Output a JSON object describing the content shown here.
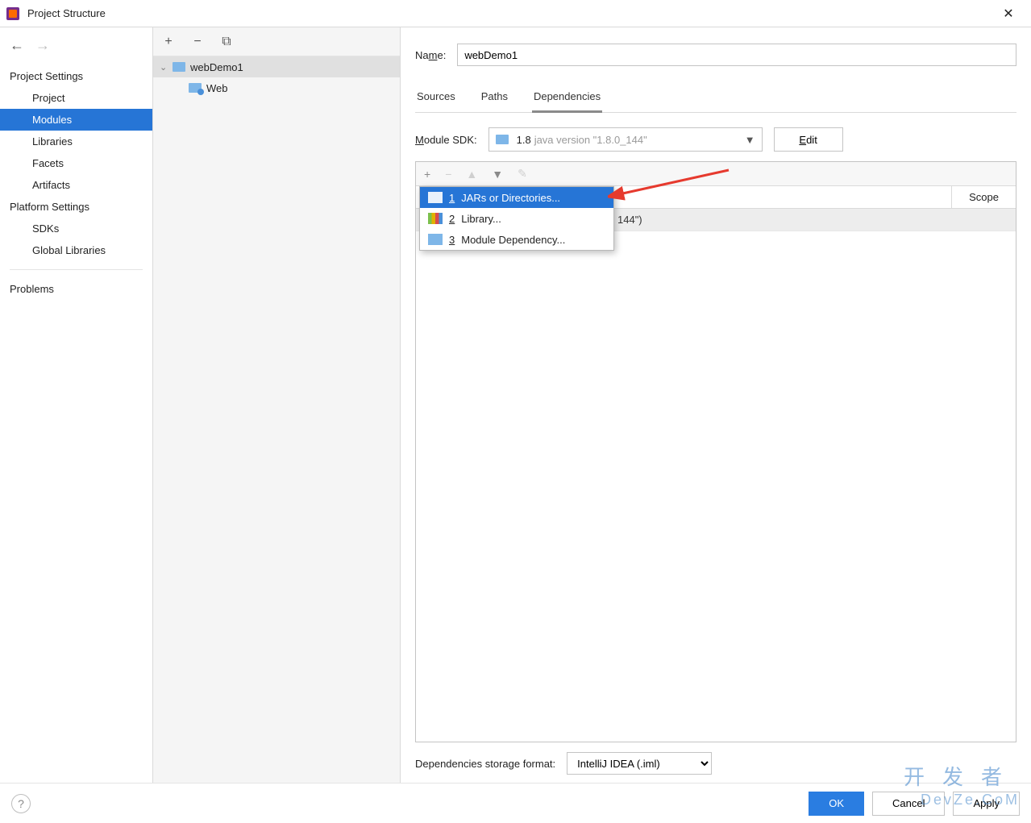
{
  "window": {
    "title": "Project Structure",
    "close_glyph": "✕"
  },
  "sidebar_nav": {
    "back_enabled": true,
    "forward_enabled": false,
    "groups": [
      {
        "heading": "Project Settings",
        "items": [
          {
            "label": "Project",
            "id": "project",
            "selected": false
          },
          {
            "label": "Modules",
            "id": "modules",
            "selected": true
          },
          {
            "label": "Libraries",
            "id": "libraries",
            "selected": false
          },
          {
            "label": "Facets",
            "id": "facets",
            "selected": false
          },
          {
            "label": "Artifacts",
            "id": "artifacts",
            "selected": false
          }
        ]
      },
      {
        "heading": "Platform Settings",
        "items": [
          {
            "label": "SDKs",
            "id": "sdks",
            "selected": false
          },
          {
            "label": "Global Libraries",
            "id": "globlib",
            "selected": false
          }
        ]
      },
      {
        "heading": null,
        "divider": true,
        "items": [
          {
            "label": "Problems",
            "id": "problems",
            "selected": false
          }
        ]
      }
    ]
  },
  "tree": {
    "toolbar": {
      "add": "+",
      "remove": "−",
      "copy": "⧉"
    },
    "root": {
      "label": "webDemo1",
      "expanded": true,
      "selected": true
    },
    "children": [
      {
        "label": "Web",
        "icon": "web"
      }
    ]
  },
  "details": {
    "name_label_prefix": "Na",
    "name_label_ul": "m",
    "name_label_suffix": "e:",
    "name_value": "webDemo1",
    "tabs": [
      {
        "label": "Sources",
        "active": false
      },
      {
        "label": "Paths",
        "active": false
      },
      {
        "label": "Dependencies",
        "active": true
      }
    ],
    "module_sdk": {
      "label_ul": "M",
      "label_rest": "odule SDK:",
      "version": "1.8",
      "description": "java version \"1.8.0_144\"",
      "edit_ul": "E",
      "edit_rest": "dit"
    },
    "dep_toolbar": {
      "add": "+",
      "remove": "−",
      "up": "▲",
      "down": "▼",
      "edit": "✎"
    },
    "dep_header": {
      "scope": "Scope"
    },
    "dep_row_partial": "144\")",
    "add_menu": [
      {
        "num": "1",
        "label": "JARs or Directories...",
        "icon": "jar",
        "selected": true
      },
      {
        "num": "2",
        "label": "Library...",
        "icon": "lib",
        "selected": false
      },
      {
        "num": "3",
        "label": "Module Dependency...",
        "icon": "mod",
        "selected": false
      }
    ],
    "storage": {
      "label": "Dependencies storage format:",
      "value": "IntelliJ IDEA (.iml)"
    }
  },
  "footer": {
    "help_glyph": "?",
    "ok": "OK",
    "cancel": "Cancel",
    "apply": "Apply"
  },
  "watermark": {
    "line1": "开发者",
    "line2": "DevZe.CoM"
  }
}
